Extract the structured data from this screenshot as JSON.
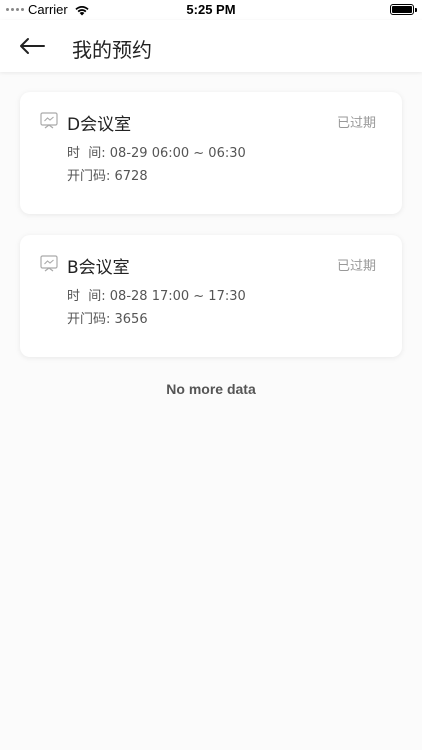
{
  "status_bar": {
    "carrier": "Carrier",
    "time": "5:25 PM"
  },
  "header": {
    "title": "我的预约"
  },
  "reservations": [
    {
      "room": "D会议室",
      "status": "已过期",
      "time_label": "时  间: ",
      "time_value": "08-29 06:00 ~ 06:30",
      "code_label": "开门码: ",
      "code_value": "6728"
    },
    {
      "room": "B会议室",
      "status": "已过期",
      "time_label": "时  间: ",
      "time_value": "08-28 17:00 ~ 17:30",
      "code_label": "开门码: ",
      "code_value": "3656"
    }
  ],
  "footer": {
    "no_more": "No more data"
  },
  "colors": {
    "background": "#fbfbfb",
    "card": "#ffffff",
    "muted_text": "#999999"
  }
}
